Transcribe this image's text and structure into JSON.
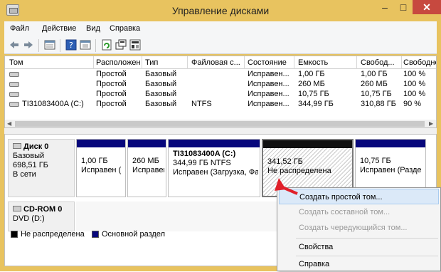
{
  "window": {
    "title": "Управление дисками"
  },
  "menu": [
    "Файл",
    "Действие",
    "Вид",
    "Справка"
  ],
  "toolbar_icons": [
    "back-arrow-icon",
    "forward-arrow-icon",
    "properties-icon",
    "help-icon",
    "refresh-icon",
    "rescan-icon",
    "settings-icon"
  ],
  "columns": [
    "Том",
    "Расположение",
    "Тип",
    "Файловая с...",
    "Состояние",
    "Емкость",
    "Свобод...",
    "Свободно"
  ],
  "volumes": [
    {
      "name": "",
      "layout": "Простой",
      "type": "Базовый",
      "fs": "",
      "status": "Исправен...",
      "capacity": "1,00 ГБ",
      "free": "1,00 ГБ",
      "pct": "100 %"
    },
    {
      "name": "",
      "layout": "Простой",
      "type": "Базовый",
      "fs": "",
      "status": "Исправен...",
      "capacity": "260 МБ",
      "free": "260 МБ",
      "pct": "100 %"
    },
    {
      "name": "",
      "layout": "Простой",
      "type": "Базовый",
      "fs": "",
      "status": "Исправен...",
      "capacity": "10,75 ГБ",
      "free": "10,75 ГБ",
      "pct": "100 %"
    },
    {
      "name": "TI31083400A (C:)",
      "layout": "Простой",
      "type": "Базовый",
      "fs": "NTFS",
      "status": "Исправен...",
      "capacity": "344,99 ГБ",
      "free": "310,88 ГБ",
      "pct": "90 %"
    }
  ],
  "disk0": {
    "name": "Диск 0",
    "type": "Базовый",
    "size": "698,51 ГБ",
    "state": "В сети"
  },
  "partitions": [
    {
      "line1": "",
      "line2": "1,00 ГБ",
      "line3": "Исправен ("
    },
    {
      "line1": "",
      "line2": "260 МБ",
      "line3": "Исправен"
    },
    {
      "line1": "TI31083400A  (C:)",
      "line2": "344,99 ГБ NTFS",
      "line3": "Исправен (Загрузка, Фа"
    },
    {
      "line1": "",
      "line2": "341,52 ГБ",
      "line3": "Не распределена"
    },
    {
      "line1": "",
      "line2": "10,75 ГБ",
      "line3": "Исправен (Разде"
    }
  ],
  "cdrom": {
    "name": "CD-ROM 0",
    "drive": "DVD (D:)"
  },
  "legend": [
    {
      "label": "Не распределена",
      "color": "#000000"
    },
    {
      "label": "Основной раздел",
      "color": "#07077c"
    }
  ],
  "context_menu": [
    {
      "label": "Создать простой том...",
      "enabled": true,
      "highlighted": true
    },
    {
      "label": "Создать составной том...",
      "enabled": false
    },
    {
      "label": "Создать чередующийся том...",
      "enabled": false
    },
    {
      "label": "Свойства",
      "enabled": true
    },
    {
      "label": "Справка",
      "enabled": true
    }
  ],
  "colors": {
    "titlebar": "#e8c35f",
    "primary_partition": "#07077c",
    "unallocated": "#000000",
    "close_button": "#c7493f",
    "arrow": "#e0202a"
  }
}
